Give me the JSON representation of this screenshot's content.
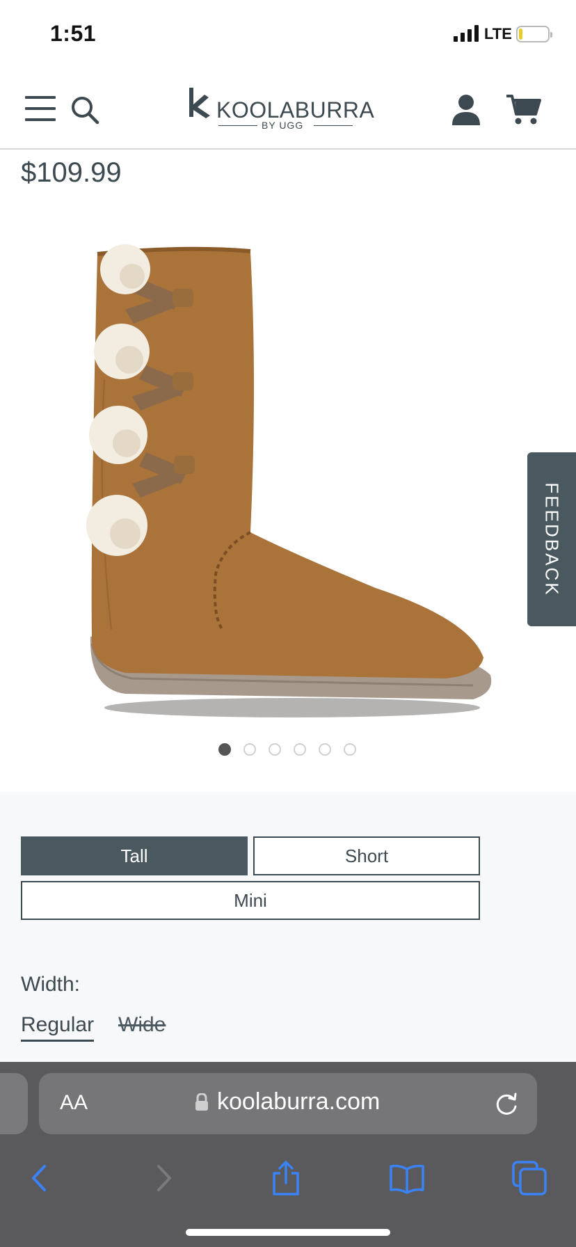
{
  "status_bar": {
    "time": "1:51",
    "network": "LTE"
  },
  "header": {
    "logo_word": "KOOLABURRA",
    "logo_sub": "BY UGG"
  },
  "product": {
    "price": "$109.99",
    "image_count": 6,
    "active_image": 1
  },
  "feedback": {
    "label": "FEEDBACK"
  },
  "style_options": [
    {
      "label": "Tall",
      "selected": true
    },
    {
      "label": "Short",
      "selected": false
    },
    {
      "label": "Mini",
      "selected": false
    }
  ],
  "width": {
    "label": "Width:",
    "options": [
      {
        "label": "Regular",
        "active": true
      },
      {
        "label": "Wide",
        "available": false
      }
    ]
  },
  "browser": {
    "aa_label": "AA",
    "url": "koolaburra.com"
  },
  "colors": {
    "brand_slate": "#4a5860",
    "text": "#3d4950",
    "boot_chestnut": "#a9733a",
    "browser_accent": "#3b82f6"
  }
}
